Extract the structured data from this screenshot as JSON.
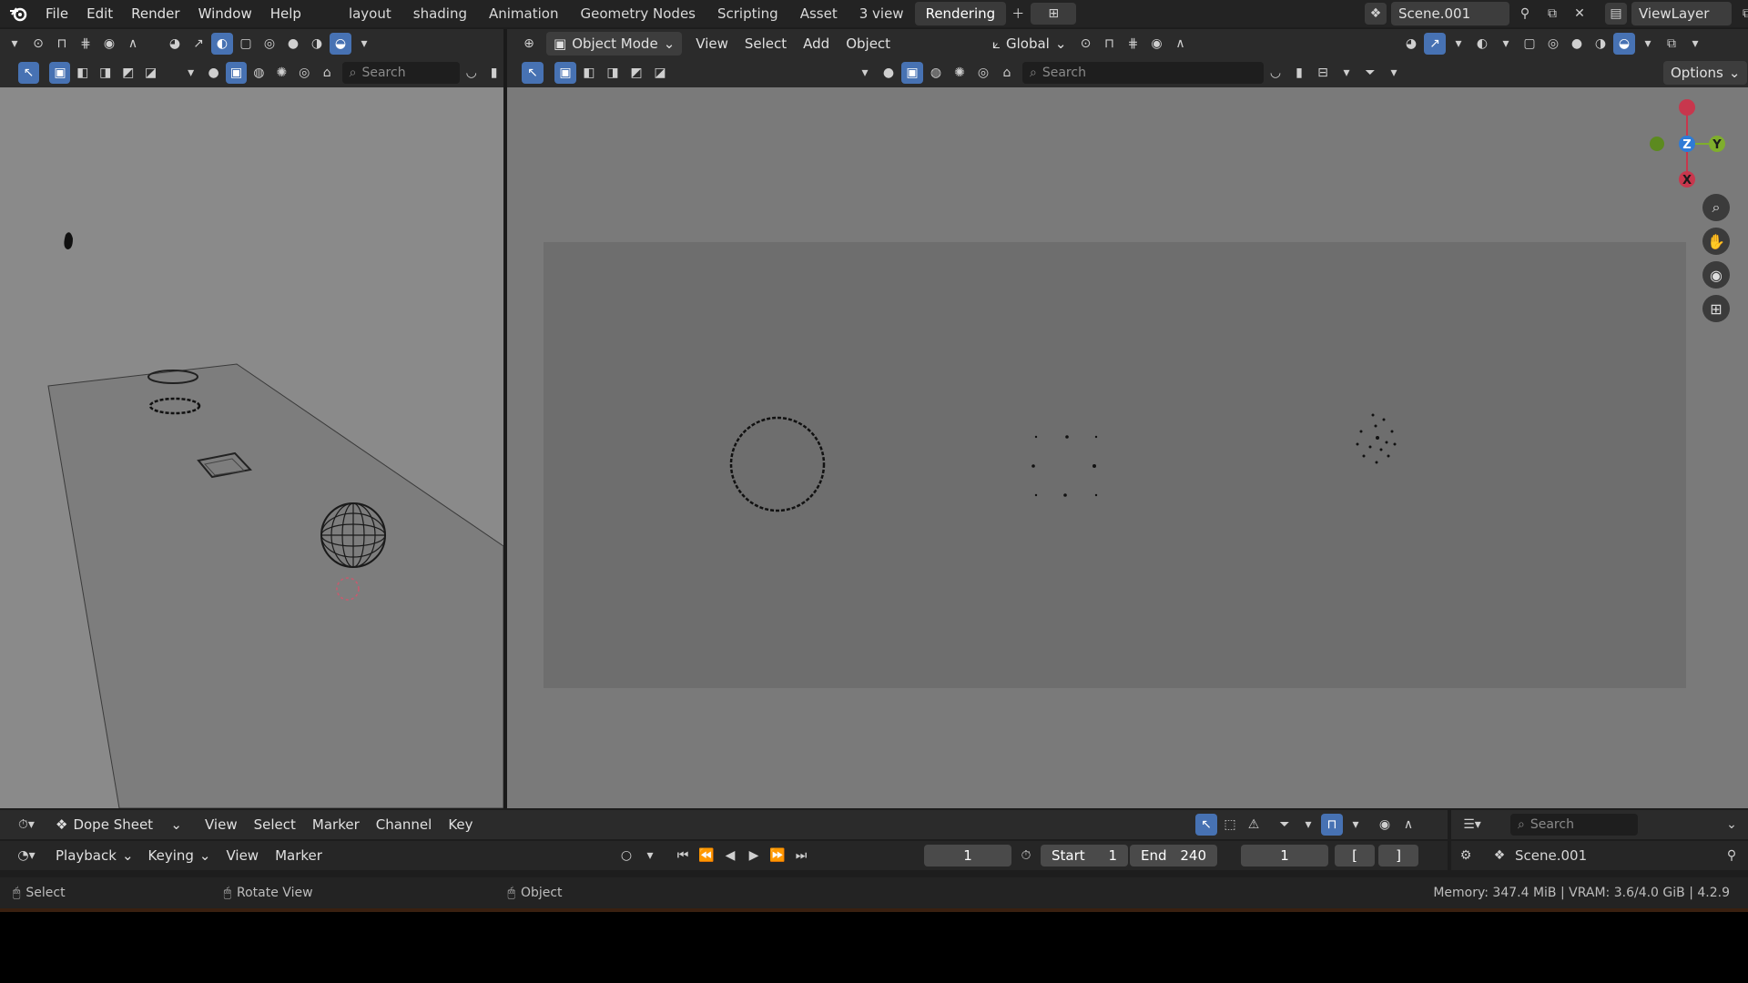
{
  "menus": [
    "File",
    "Edit",
    "Render",
    "Window",
    "Help"
  ],
  "workspaces": [
    "layout",
    "shading",
    "Animation",
    "Geometry Nodes",
    "Scripting",
    "Asset",
    "3 view",
    "Rendering"
  ],
  "active_workspace": "Rendering",
  "scene": {
    "name": "Scene.001",
    "view_layer": "ViewLayer"
  },
  "left_viewport": {
    "search_placeholder": "Search"
  },
  "right_viewport": {
    "mode": "Object Mode",
    "menus": [
      "View",
      "Select",
      "Add",
      "Object"
    ],
    "transform_orientation": "Global",
    "search_placeholder": "Search",
    "options_label": "Options",
    "axis_labels": {
      "z": "Z",
      "y": "Y",
      "x": "X"
    }
  },
  "dopesheet": {
    "editor_label": "Dope Sheet",
    "menus": [
      "View",
      "Select",
      "Marker",
      "Channel",
      "Key"
    ],
    "search_placeholder": "Search"
  },
  "timeline": {
    "menus": [
      "Playback",
      "Keying",
      "View",
      "Marker"
    ],
    "current_frame": "1",
    "start_label": "Start",
    "start": "1",
    "end_label": "End",
    "end": "240",
    "frame2": "1",
    "scene_name": "Scene.001"
  },
  "status": {
    "select": "Select",
    "rotate": "Rotate View",
    "object": "Object",
    "memory": "Memory: 347.4 MiB | VRAM: 3.6/4.0 GiB | 4.2.9"
  },
  "colors": {
    "accent": "#4772b3",
    "x_axis": "#c8374d",
    "y_axis": "#7fae2c",
    "z_axis": "#2e7bd6"
  }
}
